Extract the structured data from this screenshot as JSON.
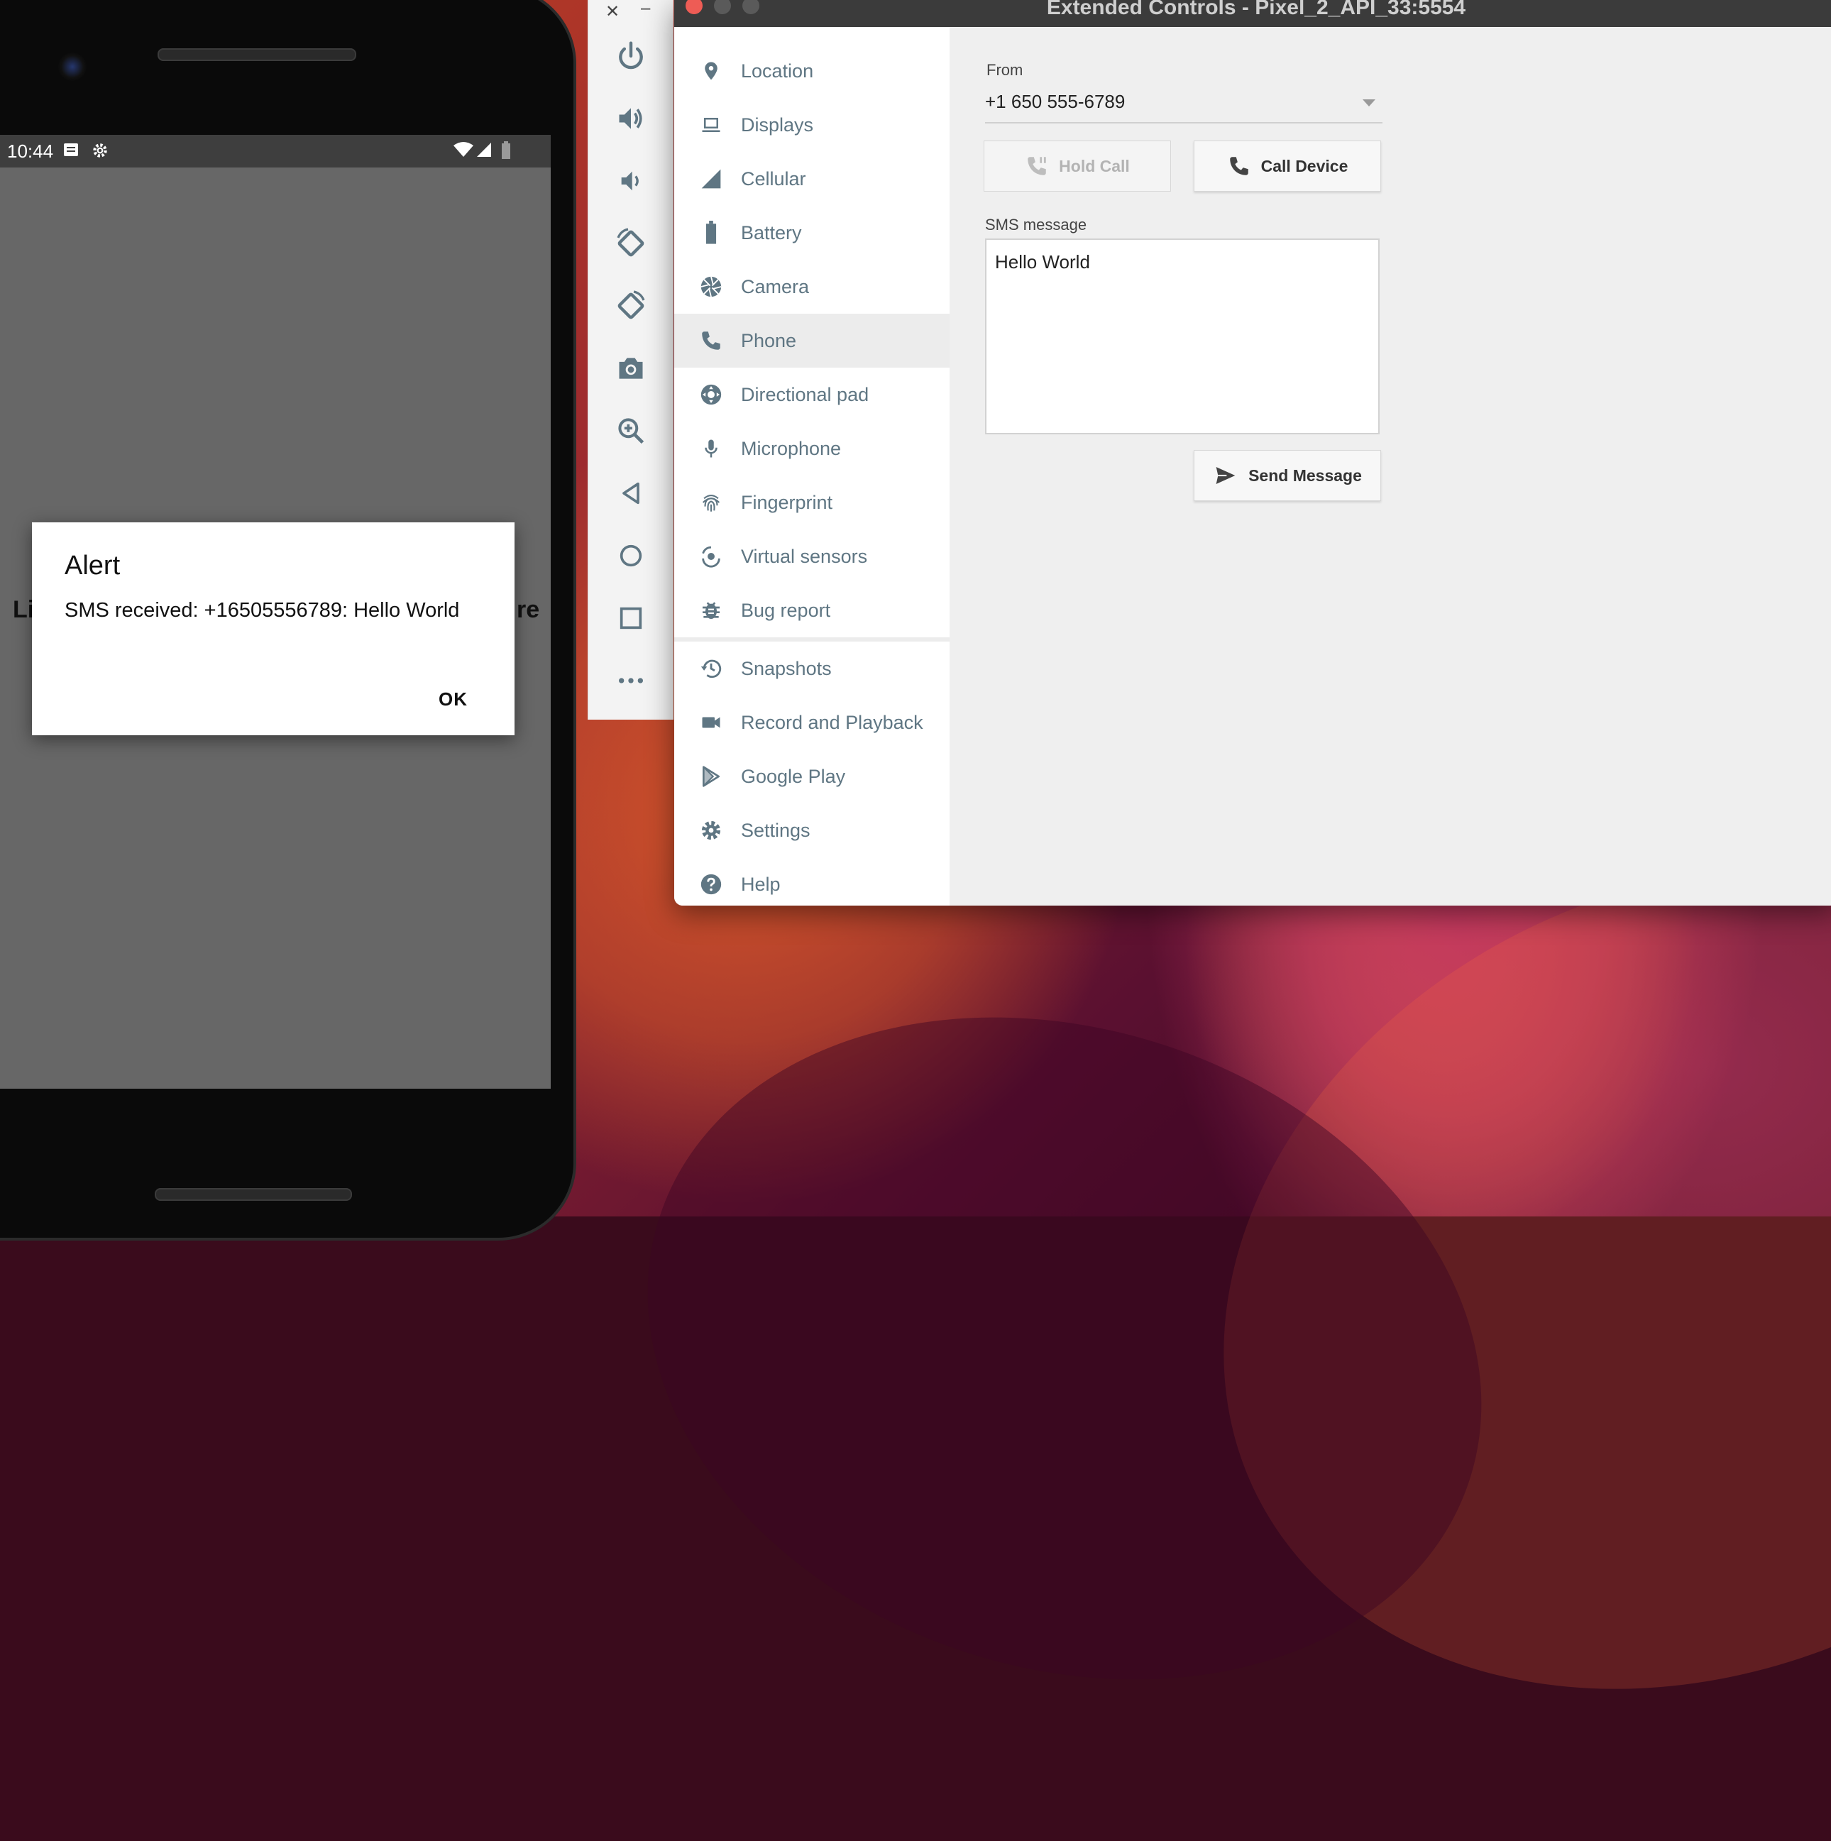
{
  "phone": {
    "status_time": "10:44",
    "bg_text_left": "Li",
    "bg_text_right": "re",
    "dialog": {
      "title": "Alert",
      "message": "SMS received: +16505556789: Hello World",
      "ok_label": "OK"
    }
  },
  "emulator_toolbar": {
    "close_glyph": "✕",
    "minimize_glyph": "–",
    "buttons": [
      "power-icon",
      "volume-up-icon",
      "volume-down-icon",
      "rotate-left-icon",
      "rotate-right-icon",
      "screenshot-icon",
      "zoom-icon",
      "back-icon",
      "home-icon",
      "overview-icon",
      "more-icon"
    ]
  },
  "window": {
    "title": "Extended Controls - Pixel_2_API_33:5554"
  },
  "sidebar": {
    "items": [
      {
        "label": "Location",
        "icon": "location-pin-icon"
      },
      {
        "label": "Displays",
        "icon": "display-icon"
      },
      {
        "label": "Cellular",
        "icon": "cellular-signal-icon"
      },
      {
        "label": "Battery",
        "icon": "battery-icon"
      },
      {
        "label": "Camera",
        "icon": "camera-aperture-icon"
      },
      {
        "label": "Phone",
        "icon": "phone-icon",
        "active": true
      },
      {
        "label": "Directional pad",
        "icon": "dpad-icon"
      },
      {
        "label": "Microphone",
        "icon": "microphone-icon"
      },
      {
        "label": "Fingerprint",
        "icon": "fingerprint-icon"
      },
      {
        "label": "Virtual sensors",
        "icon": "virtual-sensors-icon"
      },
      {
        "label": "Bug report",
        "icon": "bug-icon"
      },
      {
        "label": "Snapshots",
        "icon": "history-icon"
      },
      {
        "label": "Record and Playback",
        "icon": "video-camera-icon"
      },
      {
        "label": "Google Play",
        "icon": "google-play-icon"
      },
      {
        "label": "Settings",
        "icon": "gear-icon"
      },
      {
        "label": "Help",
        "icon": "help-icon"
      }
    ]
  },
  "phone_panel": {
    "from_label": "From",
    "from_value": "+1 650 555-6789",
    "hold_call_label": "Hold Call",
    "call_device_label": "Call Device",
    "sms_label": "SMS message",
    "sms_value": "Hello World",
    "send_message_label": "Send Message"
  },
  "colors": {
    "sidebar_icon": "#5f7683",
    "sidebar_text": "#5f7683",
    "titlebar": "#3b3b3b",
    "close_button": "#ee5c55",
    "inactive_button": "#5a5a5a",
    "dialog_bg": "#ffffff",
    "phone_screen": "#676767"
  }
}
